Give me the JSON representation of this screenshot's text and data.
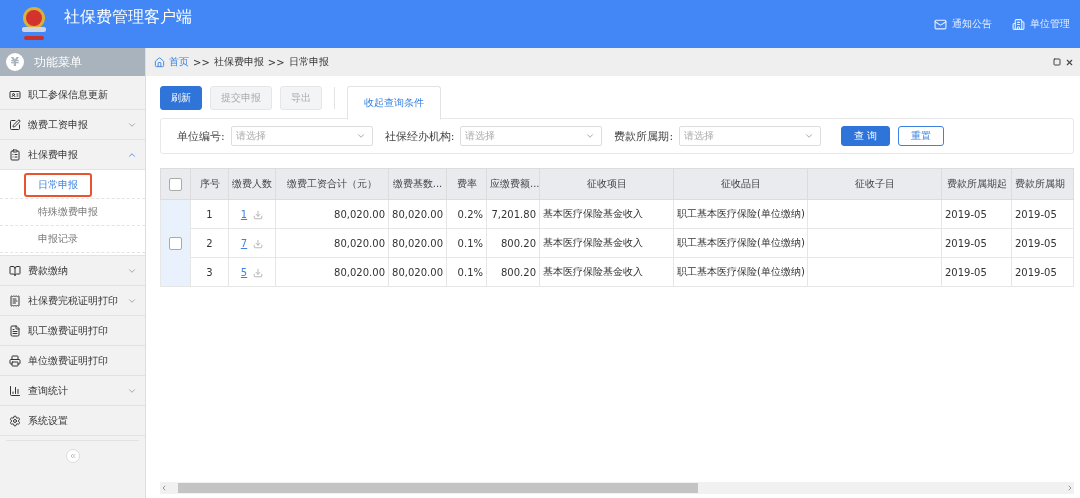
{
  "header": {
    "title": "社保费管理客户端",
    "actions": [
      {
        "label": "通知公告"
      },
      {
        "label": "单位管理"
      }
    ]
  },
  "sidebar": {
    "title": "功能菜单",
    "title_glyph": "¥",
    "items": [
      {
        "label": "职工参保信息更新",
        "expandable": false
      },
      {
        "label": "缴费工资申报",
        "expandable": true,
        "expanded": false
      },
      {
        "label": "社保费申报",
        "expandable": true,
        "expanded": true,
        "children": [
          {
            "label": "日常申报",
            "selected": true
          },
          {
            "label": "特殊缴费申报",
            "selected": false
          },
          {
            "label": "申报记录",
            "selected": false
          }
        ]
      },
      {
        "label": "费款缴纳",
        "expandable": true,
        "expanded": false
      },
      {
        "label": "社保费完税证明打印",
        "expandable": true,
        "expanded": false
      },
      {
        "label": "职工缴费证明打印",
        "expandable": false
      },
      {
        "label": "单位缴费证明打印",
        "expandable": false
      },
      {
        "label": "查询统计",
        "expandable": true,
        "expanded": false
      },
      {
        "label": "系统设置",
        "expandable": false
      }
    ]
  },
  "breadcrumb": [
    "首页",
    "社保费申报",
    "日常申报"
  ],
  "breadcrumb_separator": ">>",
  "toolbar": [
    {
      "label": "刷新",
      "kind": "primary",
      "disabled": false
    },
    {
      "label": "提交申报",
      "kind": "default",
      "disabled": true
    },
    {
      "label": "导出",
      "kind": "default",
      "disabled": true
    }
  ],
  "filter_toggle": {
    "label": "收起查询条件",
    "selected": true
  },
  "filters": [
    {
      "label": "单位编号:",
      "placeholder": "请选择"
    },
    {
      "label": "社保经办机构:",
      "placeholder": "请选择"
    },
    {
      "label": "费款所属期:",
      "placeholder": "请选择"
    }
  ],
  "filter_buttons": [
    {
      "label": "查 询",
      "kind": "primary"
    },
    {
      "label": "重置",
      "kind": "outline"
    }
  ],
  "table": {
    "header_checked": false,
    "group_checked": false,
    "columns": [
      "序号",
      "缴费人数",
      "缴费工资合计（元）",
      "缴费基数...",
      "费率",
      "应缴费额...",
      "征收项目",
      "征收品目",
      "征收子目",
      "费款所属期起",
      "费款所属期"
    ],
    "rows": [
      [
        "1",
        "1",
        "80,020.00",
        "80,020.00",
        "0.2%",
        "7,201.80",
        "基本医疗保险基金收入",
        "职工基本医疗保险(单位缴纳)",
        "",
        "2019-05",
        "2019-05"
      ],
      [
        "2",
        "7",
        "80,020.00",
        "80,020.00",
        "0.1%",
        "800.20",
        "基本医疗保险基金收入",
        "职工基本医疗保险(单位缴纳)",
        "",
        "2019-05",
        "2019-05"
      ],
      [
        "3",
        "5",
        "80,020.00",
        "80,020.00",
        "0.1%",
        "800.20",
        "基本医疗保险基金收入",
        "职工基本医疗保险(单位缴纳)",
        "",
        "2019-05",
        "2019-05"
      ]
    ]
  }
}
